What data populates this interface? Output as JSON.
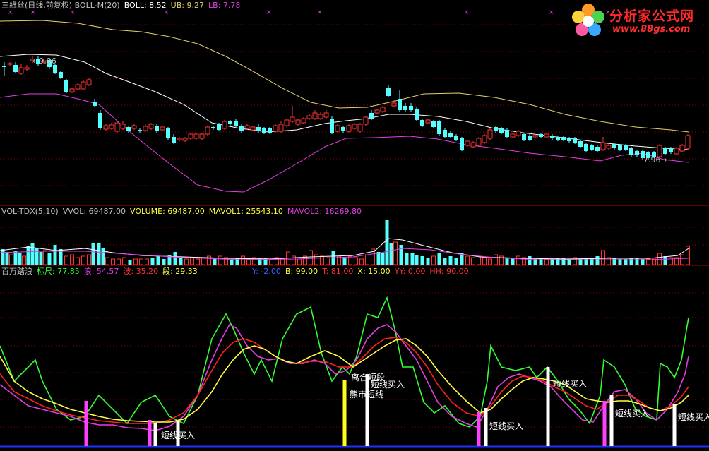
{
  "colors": {
    "up": "#ff3232",
    "down": "#54ffff",
    "boll_mid": "#ffffff",
    "boll_band": "#e0d070",
    "boll_lb": "#e040e0",
    "grid": "#8b0000",
    "vol_ma1": "#ffffff",
    "vol_ma2": "#e040e0",
    "wave_green": "#33ff33",
    "wave_magenta": "#e040e0",
    "wave_red": "#ff2020",
    "wave_yellow": "#ffff40"
  },
  "main_panel": {
    "title": "三維丝(日线,前复权) BOLL-M(20)",
    "boll": "BOLL: 8.52",
    "ub": "UB: 9.27",
    "lb": "LB: 7.78",
    "high_tag": "9.96",
    "low_tag": "7.96",
    "low_arrow": "→"
  },
  "vol_panel": {
    "title": "VOL-TDX(5,10)",
    "vvol": "VVOL: 69487.00",
    "volume": "VOLUME: 69487.00",
    "mavol1": "MAVOL1: 25543.10",
    "mavol2": "MAVOL2: 16269.80"
  },
  "wave_panel": {
    "title": "百万踏浪",
    "biaochi": "标尺: 77.85",
    "lang": "浪: 54.57",
    "bo": "波: 35.20",
    "duan": "段: 29.33",
    "y": "Y: -2.00",
    "b": "B: 99.00",
    "t": "T: 81.00",
    "x": "X: 15.00",
    "yy": "YY: 0.00",
    "hh": "HH: 90.00"
  },
  "signals": [
    {
      "label": "短线买入"
    },
    {
      "label": "离合短段"
    },
    {
      "label": "短线买入"
    },
    {
      "label": "熊市短线"
    },
    {
      "label": "短线买入"
    },
    {
      "label": "短线买入"
    },
    {
      "label": "短线买入"
    },
    {
      "label": "短线买入"
    }
  ],
  "logo": {
    "name": "分析家公式网",
    "url": "www.88gs.com",
    "icon": "flower-logo-icon"
  }
}
